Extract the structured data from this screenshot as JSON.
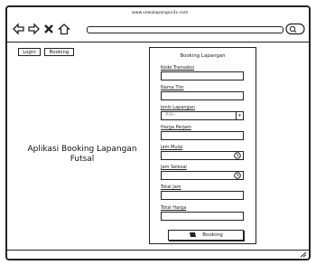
{
  "browser": {
    "url": "www.sewalapangan3x.com",
    "icons": [
      "back-icon",
      "forward-icon",
      "close-icon",
      "home-icon",
      "search-icon"
    ]
  },
  "toolbar": {
    "login_label": "Login",
    "booking_label": "Booking"
  },
  "app_title": "Aplikasi Booking Lapangan Futsal",
  "form": {
    "title": "Booking Lapangan",
    "fields": {
      "kode_transaksi": {
        "label": "Kode Transaksi",
        "value": ""
      },
      "nama_tim": {
        "label": "Nama Tim",
        "value": ""
      },
      "jenis_lapangan": {
        "label": "Jenis Lapangan",
        "value": "-Pilih-"
      },
      "harga_perjam": {
        "label": "Harga Perjam",
        "value": ""
      },
      "jam_mulai": {
        "label": "Jam Mulai",
        "value": "- -"
      },
      "jam_selesai": {
        "label": "Jam Selesai",
        "value": "- -"
      },
      "total_jam": {
        "label": "Total Jam",
        "value": ""
      },
      "total_harga": {
        "label": "Total Harga",
        "value": ""
      }
    },
    "submit_label": "Booking"
  }
}
